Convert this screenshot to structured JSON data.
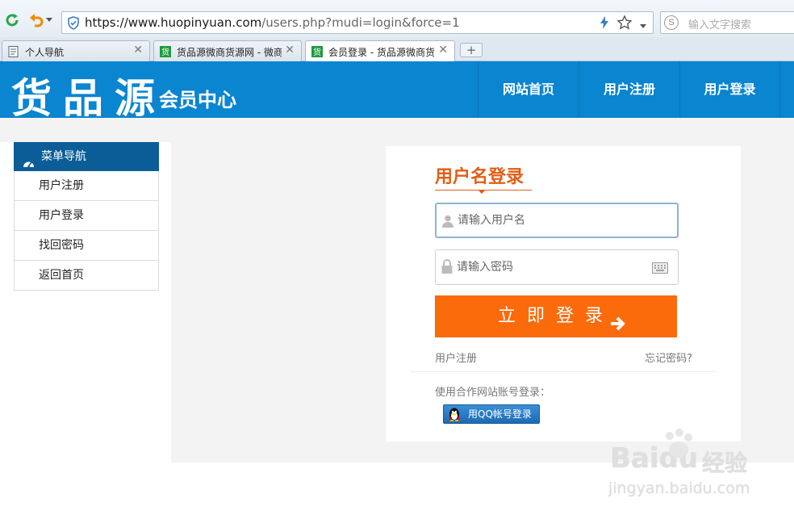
{
  "browser": {
    "url_host": "https://www.huopinyuan.com",
    "url_path": "/users.php?mudi=login&force=1",
    "search_placeholder": "输入文字搜索",
    "search_engine_glyph": "S",
    "tabs": [
      {
        "title": "个人导航",
        "active": false
      },
      {
        "title": "货品源微商货源网 - 微商",
        "active": false
      },
      {
        "title": "会员登录 - 货品源微商货",
        "active": true
      }
    ],
    "new_tab_label": "+"
  },
  "site": {
    "logo_main": "货品源",
    "logo_sub": "会员中心",
    "header_nav": [
      "网站首页",
      "用户注册",
      "用户登录"
    ],
    "brand_color": "#0a85d0",
    "accent_color": "#fb6b0b"
  },
  "sidebar": {
    "header": "菜单导航",
    "items": [
      "用户注册",
      "用户登录",
      "找回密码",
      "返回首页"
    ]
  },
  "login": {
    "title": "用户名登录",
    "username_placeholder": "请输入用户名",
    "password_placeholder": "请输入密码",
    "submit_label": "立即登录",
    "register_link": "用户注册",
    "forgot_link": "忘记密码?",
    "partner_label": "使用合作网站账号登录：",
    "qq_button": "用QQ帐号登录"
  },
  "watermark": {
    "brand": "Baidu",
    "brand_cn": "经验",
    "domain": "jingyan.baidu.com"
  }
}
